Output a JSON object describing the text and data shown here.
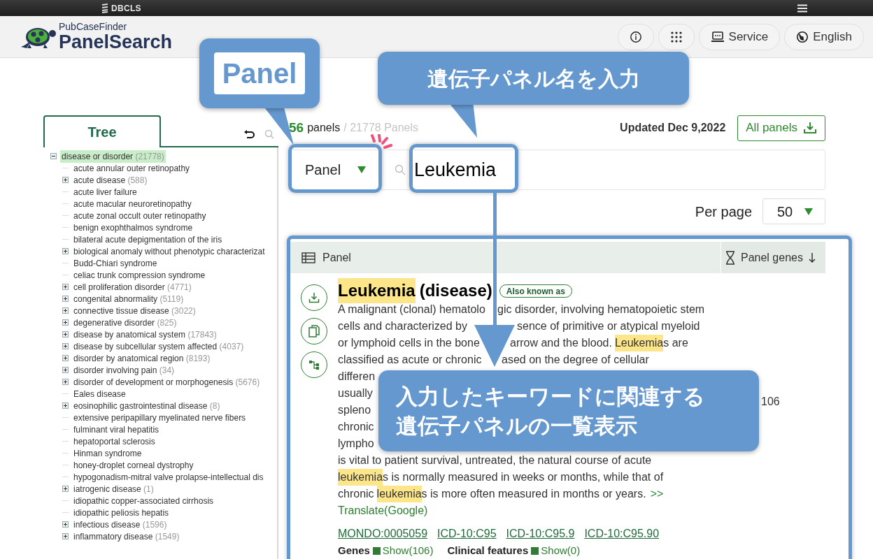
{
  "topbar": {
    "brand": "DBCLS"
  },
  "header": {
    "logo_small": "PubCaseFinder",
    "logo_large": "PanelSearch",
    "buttons": [
      {
        "kind": "info"
      },
      {
        "kind": "apps"
      },
      {
        "kind": "service",
        "label": "Service"
      },
      {
        "kind": "language",
        "label": "English"
      }
    ]
  },
  "sidebar": {
    "tabs": [
      {
        "label": "Tree",
        "selected": true
      }
    ],
    "tree": [
      {
        "label": "disease or disorder",
        "count": "(21778)",
        "expanded": true,
        "selected": true,
        "children": [
          {
            "label": "acute annular outer retinopathy",
            "selected": false
          },
          {
            "label": "acute disease",
            "count": "(588)",
            "expanded": false,
            "selected": false
          },
          {
            "label": "acute liver failure",
            "selected": false
          },
          {
            "label": "acute macular neuroretinopathy",
            "selected": false
          },
          {
            "label": "acute zonal occult outer retinopathy",
            "selected": false
          },
          {
            "label": "benign exophthalmos syndrome",
            "selected": false
          },
          {
            "label": "bilateral acute depigmentation of the iris",
            "selected": false
          },
          {
            "label": "biological anomaly without phenotypic characterizat",
            "expanded": false,
            "selected": false
          },
          {
            "label": "Budd-Chiari syndrome",
            "selected": false
          },
          {
            "label": "celiac trunk compression syndrome",
            "selected": false
          },
          {
            "label": "cell proliferation disorder",
            "count": "(4771)",
            "expanded": false,
            "selected": false
          },
          {
            "label": "congenital abnormality",
            "count": "(5119)",
            "expanded": false,
            "selected": false
          },
          {
            "label": "connective tissue disease",
            "count": "(3022)",
            "expanded": false,
            "selected": false
          },
          {
            "label": "degenerative disorder",
            "count": "(825)",
            "expanded": false,
            "selected": false
          },
          {
            "label": "disease by anatomical system",
            "count": "(17843)",
            "expanded": false,
            "selected": false
          },
          {
            "label": "disease by subcellular system affected",
            "count": "(4037)",
            "expanded": false,
            "selected": false
          },
          {
            "label": "disorder by anatomical region",
            "count": "(8193)",
            "expanded": false,
            "selected": false
          },
          {
            "label": "disorder involving pain",
            "count": "(34)",
            "expanded": false,
            "selected": false
          },
          {
            "label": "disorder of development or morphogenesis",
            "count": "(5676)",
            "expanded": false,
            "selected": false
          },
          {
            "label": "Eales disease",
            "selected": false
          },
          {
            "label": "eosinophilic gastrointestinal disease",
            "count": "(8)",
            "expanded": false,
            "selected": false
          },
          {
            "label": "extensive peripapillary myelinated nerve fibers",
            "selected": false
          },
          {
            "label": "fulminant viral hepatitis",
            "selected": false
          },
          {
            "label": "hepatoportal sclerosis",
            "selected": false
          },
          {
            "label": "Hinman syndrome",
            "selected": false
          },
          {
            "label": "honey-droplet corneal dystrophy",
            "selected": false
          },
          {
            "label": "hypogonadism-mitral valve prolapse-intellectual dis",
            "selected": false
          },
          {
            "label": "iatrogenic disease",
            "count": "(1)",
            "expanded": false,
            "selected": false
          },
          {
            "label": "idiopathic copper-associated cirrhosis",
            "selected": false
          },
          {
            "label": "idiopathic peliosis hepatis",
            "selected": false
          },
          {
            "label": "infectious disease",
            "count": "(1596)",
            "expanded": false,
            "selected": false
          },
          {
            "label": "inflammatory disease",
            "count": "(1549)",
            "expanded": false,
            "selected": false
          }
        ]
      }
    ]
  },
  "summary": {
    "count": "56",
    "count_label": "panels",
    "total": "/ 21778 Panels",
    "updated": "Updated Dec 9,2022",
    "download_button": "All panels"
  },
  "search": {
    "type_select": "Panel",
    "value": "Leukemia"
  },
  "per_page": {
    "label": "Per page",
    "value": "50"
  },
  "table": {
    "columns": [
      {
        "label": "Panel",
        "kind": "panel"
      },
      {
        "label": "Panel genes",
        "kind": "genes",
        "sorted": true
      }
    ],
    "rows": [
      {
        "title": [
          {
            "text": "Leukemia",
            "highlight": true
          },
          {
            "text": "(disease)",
            "highlight": false
          }
        ],
        "aka": "Also known as",
        "description": [
          {
            "left": [
              {
                "text": "A malignant (clonal) hematolo",
                "highlight": false
              }
            ],
            "right": [
              {
                "text": "gic disorder, involving hematopoietic stem",
                "highlight": false
              }
            ]
          },
          {
            "left": [
              {
                "text": "cells and characterized by",
                "highlight": false
              }
            ],
            "right": [
              {
                "text": "sence of primitive or atypical myeloid",
                "highlight": false
              }
            ]
          },
          {
            "left": [
              {
                "text": "or lymphoid cells in the bone",
                "highlight": false
              }
            ],
            "right": [
              {
                "text": "arrow and the blood.",
                "highlight": false
              },
              {
                "text": "Leukemia",
                "highlight": true
              },
              {
                "text": "s are",
                "highlight": false
              }
            ]
          },
          {
            "left": [
              {
                "text": "classified as acute or chronic",
                "highlight": false
              }
            ],
            "right": [
              {
                "text": "ased on the degree of cellular",
                "highlight": false
              }
            ]
          },
          [
            {
              "text": "differen",
              "highlight": false
            }
          ],
          [
            {
              "text": "usually",
              "highlight": false
            }
          ],
          [
            {
              "text": "spleno",
              "highlight": false
            }
          ],
          [
            {
              "text": "chronic",
              "highlight": false
            }
          ],
          [
            {
              "text": "lympho",
              "highlight": false
            }
          ],
          [
            {
              "text": "is vital to patient survival, untreated, the natural course of acute",
              "highlight": false
            }
          ],
          [
            {
              "text": "leukemia",
              "highlight": true
            },
            {
              "text": "s is normally measured in weeks or months, while that of",
              "highlight": false
            }
          ],
          [
            {
              "text": "chronic",
              "highlight": false
            },
            {
              "text": "leukemia",
              "highlight": true
            },
            {
              "text": "s is more often measured in months or years.",
              "highlight": false
            }
          ]
        ],
        "more_link": ">>",
        "translate_link": "Translate(Google)",
        "codes": [
          "MONDO:0005059",
          "ICD-10:C95",
          "ICD-10:C95.9",
          "ICD-10:C95.90"
        ],
        "genes_label": "Genes",
        "genes_link": "Show(106)",
        "features_label": "Clinical features",
        "features_link": "Show(0)",
        "panel_genes": "106"
      }
    ]
  },
  "annotations": {
    "panel_label": "Panel",
    "input_hint": "遺伝子パネル名を入力",
    "result_note": [
      "入力したキーワードに関連する",
      "遺伝子パネルの一覧表示"
    ]
  }
}
